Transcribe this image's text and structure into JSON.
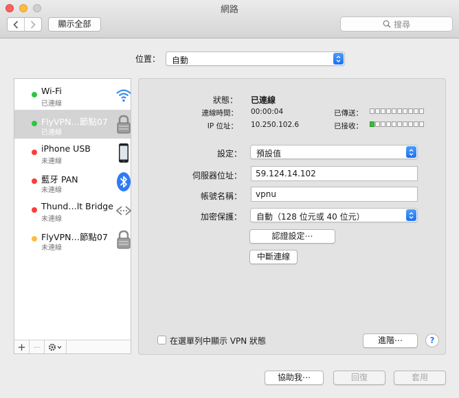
{
  "window": {
    "title": "網路"
  },
  "toolbar": {
    "show_all": "顯示全部",
    "search_placeholder": "搜尋"
  },
  "location": {
    "label": "位置：",
    "value": "自動"
  },
  "services": [
    {
      "name": "Wi-Fi",
      "status": "已連線",
      "status_color": "#28c940",
      "icon": "wifi-icon"
    },
    {
      "name": "FlyVPN…節點07",
      "status": "已連線",
      "status_color": "#28c940",
      "icon": "vpn-lock-icon",
      "selected": true
    },
    {
      "name": "iPhone USB",
      "status": "未連線",
      "status_color": "#fc3d39",
      "icon": "iphone-icon"
    },
    {
      "name": "藍牙 PAN",
      "status": "未連線",
      "status_color": "#fc3d39",
      "icon": "bluetooth-icon"
    },
    {
      "name": "Thund…lt Bridge",
      "status": "未連線",
      "status_color": "#fc3d39",
      "icon": "thunderbolt-bridge-icon"
    },
    {
      "name": "FlyVPN…節點07",
      "status": "未連線",
      "status_color": "#fdbc40",
      "icon": "vpn-lock-icon"
    }
  ],
  "sidebar_footer": {
    "add": "+",
    "remove": "—"
  },
  "detail": {
    "status_label": "狀態：",
    "status_value": "已連線",
    "connect_time_label": "連線時間：",
    "connect_time_value": "00:00:04",
    "ip_label": "IP 位址：",
    "ip_value": "10.250.102.6",
    "sent_label": "已傳送：",
    "received_label": "已接收：",
    "sent_level": 0,
    "received_level": 1,
    "meter_segments": 10,
    "config_label": "設定：",
    "config_value": "預設值",
    "server_label": "伺服器位址：",
    "server_value": "59.124.14.102",
    "account_label": "帳號名稱：",
    "account_value": "vpnu",
    "encryption_label": "加密保護：",
    "encryption_value": "自動（128 位元或 40 位元）",
    "auth_button": "認證設定⋯",
    "disconnect_button": "中斷連線",
    "show_in_menubar": "在選單列中顯示 VPN 狀態",
    "advanced_button": "進階⋯",
    "help": "?"
  },
  "footer": {
    "assist": "協助我⋯",
    "revert": "回復",
    "apply": "套用"
  },
  "colors": {
    "accent": "#1d6ff2",
    "selection": "#d4d4d4"
  }
}
